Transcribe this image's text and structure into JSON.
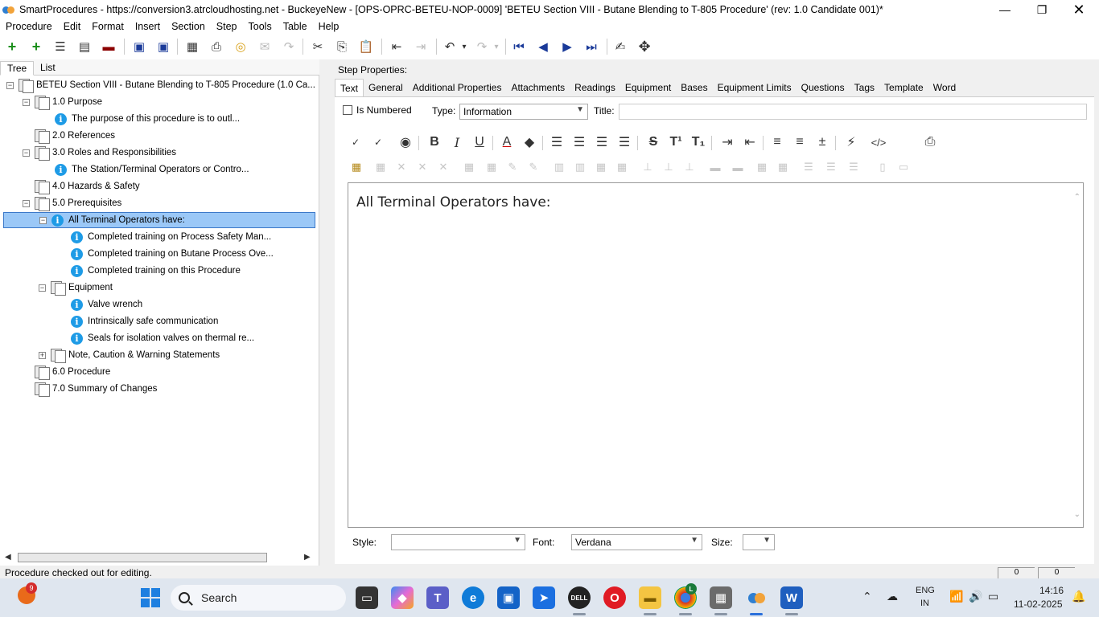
{
  "window": {
    "title": "SmartProcedures - https://conversion3.atrcloudhosting.net - BuckeyeNew - [OPS-OPRC-BETEU-NOP-0009] 'BETEU Section VIII - Butane Blending to T-805 Procedure' (rev: 1.0 Candidate 001)*",
    "min_glyph": "—",
    "max_glyph": "❐",
    "close_glyph": "✕"
  },
  "menu": [
    "Procedure",
    "Edit",
    "Format",
    "Insert",
    "Section",
    "Step",
    "Tools",
    "Table",
    "Help"
  ],
  "tree_tabs": [
    "Tree",
    "List"
  ],
  "tree": {
    "root": "BETEU Section VIII - Butane Blending to T-805 Procedure (1.0 Ca...",
    "nodes": [
      "1.0 Purpose",
      "The purpose of this procedure is to outl...",
      "2.0 References",
      "3.0 Roles and Responsibilities",
      "The Station/Terminal Operators or Contro...",
      "4.0 Hazards & Safety",
      "5.0 Prerequisites",
      "All Terminal Operators have:",
      "Completed training on Process Safety Man...",
      "Completed training on Butane Process Ove...",
      "Completed training on this Procedure",
      "Equipment",
      "Valve wrench",
      "Intrinsically safe communication",
      "Seals for isolation valves on thermal re...",
      "Note, Caution & Warning Statements",
      "6.0 Procedure",
      "7.0 Summary of Changes"
    ]
  },
  "step_properties": {
    "heading": "Step Properties:",
    "tabs": [
      "Text",
      "General",
      "Additional Properties",
      "Attachments",
      "Readings",
      "Equipment",
      "Bases",
      "Equipment Limits",
      "Questions",
      "Tags",
      "Template",
      "Word"
    ],
    "is_numbered_label": "Is Numbered",
    "type_label": "Type:",
    "type_value": "Information",
    "title_label": "Title:",
    "title_value": "",
    "editor_text": "All Terminal Operators have:",
    "style_label": "Style:",
    "style_value": "",
    "font_label": "Font:",
    "font_value": "Verdana",
    "size_label": "Size:",
    "size_value": ""
  },
  "status": {
    "text": "Procedure checked out for editing.",
    "box1": "0",
    "box2": "0"
  },
  "taskbar": {
    "weather_badge": "9",
    "search_label": "Search",
    "lang_line1": "ENG",
    "lang_line2": "IN",
    "time": "14:16",
    "date": "11-02-2025",
    "chrome_badge": "L"
  },
  "colors": {
    "selection": "#9bc8f7",
    "info_icon": "#1e9be6",
    "accent": "#2a6fdb"
  }
}
